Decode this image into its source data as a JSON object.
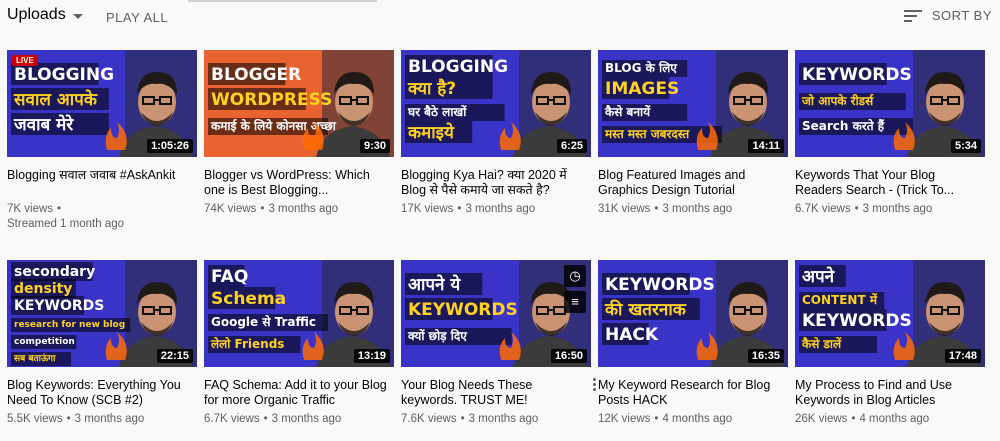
{
  "header": {
    "uploads_label": "Uploads",
    "play_all_label": "PLAY ALL",
    "sort_by_label": "SORT BY"
  },
  "videos": [
    {
      "title": "Blogging सवाल जवाब #AskAnkit",
      "views": "7K views",
      "sep": "•",
      "age": "Streamed 1 month ago",
      "duration": "1:05:26",
      "live": "LIVE",
      "thumb": {
        "bg": "#3a33c8",
        "lines": [
          "BLOGGING",
          "सवाल आपके",
          "जवाब मेरे"
        ]
      }
    },
    {
      "title": "Blogger vs WordPress: Which one is Best Blogging...",
      "views": "74K views",
      "sep": "•",
      "age": "3 months ago",
      "duration": "9:30",
      "thumb": {
        "bg": "#e8632f",
        "lines": [
          "BLOGGER",
          "WORDPRESS",
          "कमाई के लिये कोनसा अच्छा"
        ]
      }
    },
    {
      "title": "Blogging Kya Hai? क्या 2020 में Blog से पैसे कमाये जा सकते है?",
      "views": "17K views",
      "sep": "•",
      "age": "3 months ago",
      "duration": "6:25",
      "thumb": {
        "bg": "#3a33c8",
        "lines": [
          "BLOGGING",
          "क्या है?",
          "घर बैठे लाखों",
          "कमाइये"
        ]
      }
    },
    {
      "title": "Blog Featured Images and Graphics Design Tutorial",
      "views": "31K views",
      "sep": "•",
      "age": "3 months ago",
      "duration": "14:11",
      "thumb": {
        "bg": "#3a33c8",
        "lines": [
          "BLOG के लिए",
          "IMAGES",
          "कैसे बनायें",
          "मस्त मस्त जबरदस्त"
        ]
      }
    },
    {
      "title": "Keywords That Your Blog Readers Search - (Trick To...",
      "views": "6.7K views",
      "sep": "•",
      "age": "3 months ago",
      "duration": "5:34",
      "thumb": {
        "bg": "#3a33c8",
        "lines": [
          "KEYWORDS",
          "जो आपके रीडर्स",
          "Search करते हैं"
        ]
      }
    },
    {
      "title": "Blog Keywords: Everything You Need To Know (SCB #2)",
      "views": "5.5K views",
      "sep": "•",
      "age": "3 months ago",
      "duration": "22:15",
      "thumb": {
        "bg": "#3a33c8",
        "lines": [
          "secondary",
          "density",
          "KEYWORDS",
          "research for new blog",
          "competition",
          "सब बताऊंगा"
        ]
      }
    },
    {
      "title": "FAQ Schema: Add it to your Blog for more Organic Traffic",
      "views": "6.7K views",
      "sep": "•",
      "age": "3 months ago",
      "duration": "13:19",
      "thumb": {
        "bg": "#3a33c8",
        "lines": [
          "FAQ",
          "Schema",
          "Google से Traffic",
          "लेलो Friends"
        ]
      }
    },
    {
      "title": "Your Blog Needs These keywords. TRUST ME!",
      "views": "7.6K views",
      "sep": "•",
      "age": "3 months ago",
      "duration": "16:50",
      "thumb": {
        "bg": "#3a33c8",
        "lines": [
          "आपने ये",
          "KEYWORDS",
          "क्यों छोड़ दिए"
        ]
      }
    },
    {
      "title": "My Keyword Research for Blog Posts HACK",
      "views": "12K views",
      "sep": "•",
      "age": "4 months ago",
      "duration": "16:35",
      "thumb": {
        "bg": "#3a33c8",
        "lines": [
          "KEYWORDS",
          "की खतरनाक",
          "HACK"
        ]
      }
    },
    {
      "title": "My Process to Find and Use Keywords in Blog Articles",
      "views": "26K views",
      "sep": "•",
      "age": "4 months ago",
      "duration": "17:48",
      "thumb": {
        "bg": "#3a33c8",
        "lines": [
          "अपने",
          "CONTENT में",
          "KEYWORDS",
          "कैसे डालें"
        ]
      }
    }
  ],
  "colors": {
    "accent_yellow": "#ffd21f",
    "accent_red": "#cc0000",
    "thumb_blue": "#3a33c8",
    "thumb_orange": "#e8632f",
    "skin": "#c99374",
    "hair": "#1f1a17"
  },
  "icons": {
    "sort": "sort-icon",
    "caret": "chevron-down-icon",
    "clock": "watch-later-icon",
    "queue": "add-to-queue-icon",
    "more": "more-vert-icon"
  }
}
